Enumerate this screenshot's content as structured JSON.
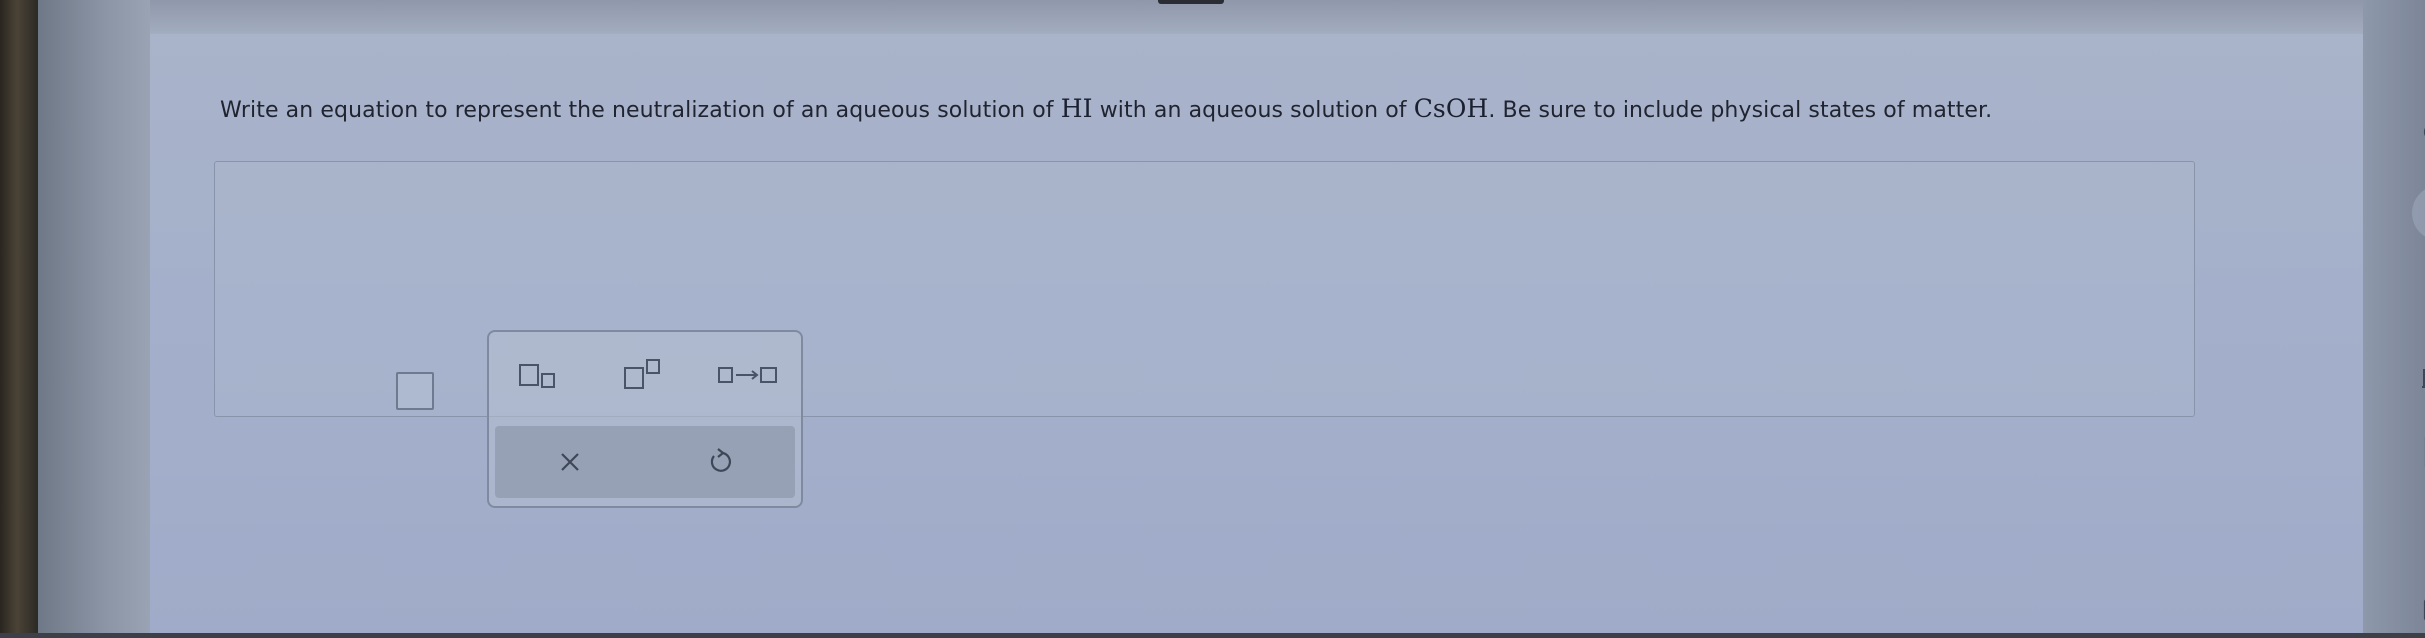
{
  "question": {
    "before_acid": "Write an equation to represent the neutralization of an aqueous solution of ",
    "acid": "HI",
    "between": " with an aqueous solution of ",
    "base": "CsOH",
    "after_base": ". Be sure to include physical states of matter."
  },
  "toolbar_icons": [
    "infinity-icon",
    "tag-icon",
    "notes-icon",
    "bar-chart-icon",
    "periodic-table-icon",
    "calculator-icon",
    "mail-icon"
  ],
  "colors": {
    "accent": "#4a5468",
    "surface": "#a6b1ca",
    "border": "#8994ab"
  }
}
